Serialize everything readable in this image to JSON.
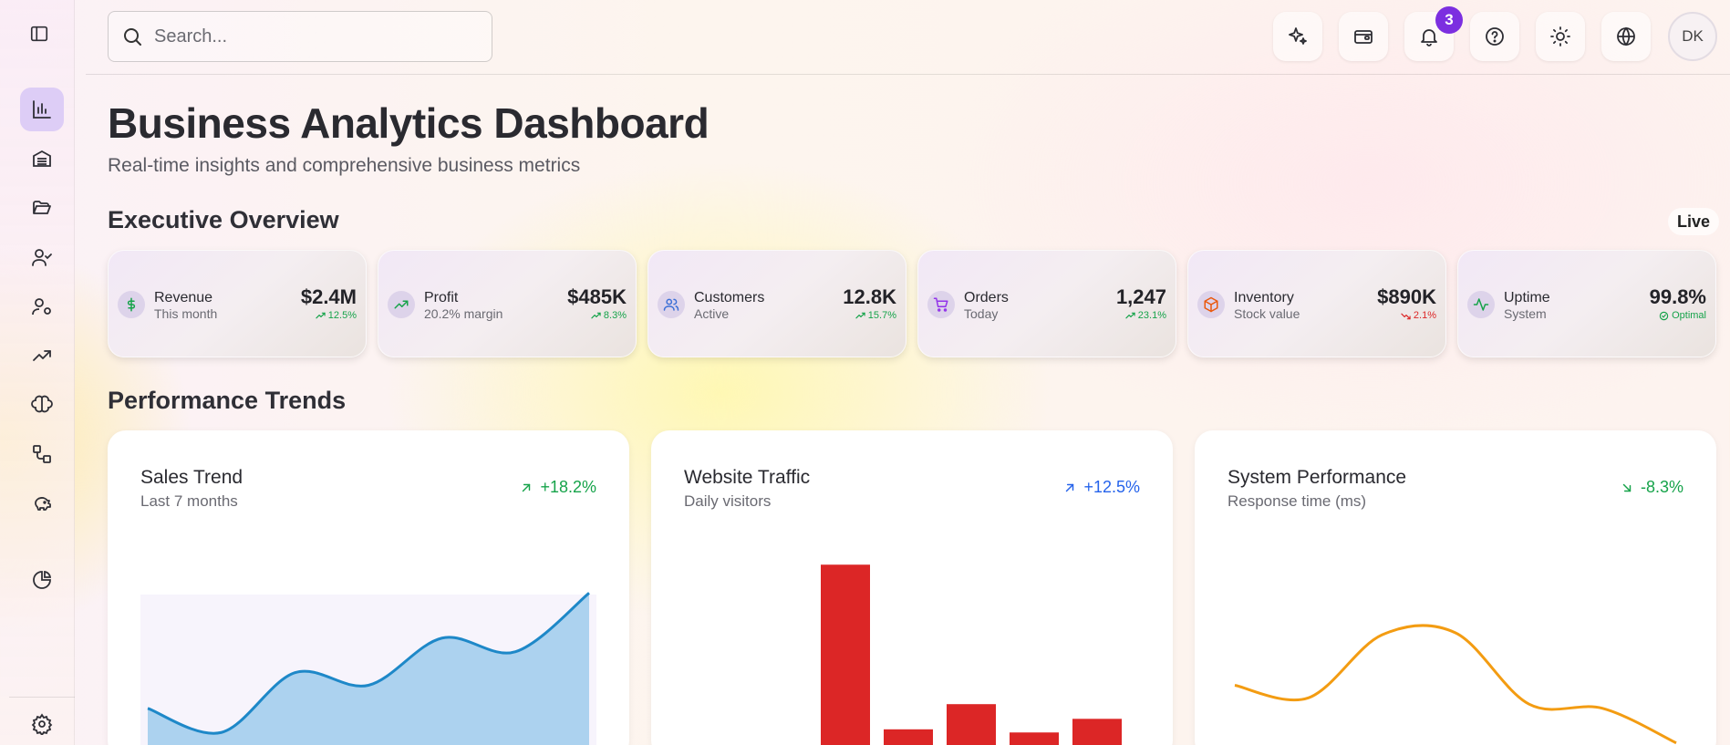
{
  "search": {
    "placeholder": "Search..."
  },
  "notifications": {
    "count": "3"
  },
  "user": {
    "initials": "DK"
  },
  "page": {
    "title": "Business Analytics Dashboard",
    "subtitle": "Real-time insights and comprehensive business metrics"
  },
  "overview": {
    "title": "Executive Overview",
    "live_label": "Live",
    "kpis": [
      {
        "name": "revenue",
        "label": "Revenue",
        "sub": "This month",
        "value": "$2.4M",
        "delta": "12.5%",
        "direction": "up",
        "color": "#16a34a",
        "icon_color": "#16a34a",
        "icon": "dollar-icon"
      },
      {
        "name": "profit",
        "label": "Profit",
        "sub": "20.2% margin",
        "value": "$485K",
        "delta": "8.3%",
        "direction": "up",
        "color": "#16a34a",
        "icon_color": "#16a34a",
        "icon": "trending-up-icon"
      },
      {
        "name": "customers",
        "label": "Customers",
        "sub": "Active",
        "value": "12.8K",
        "delta": "15.7%",
        "direction": "up",
        "color": "#16a34a",
        "icon_color": "#3b6fd6",
        "icon": "users-icon"
      },
      {
        "name": "orders",
        "label": "Orders",
        "sub": "Today",
        "value": "1,247",
        "delta": "23.1%",
        "direction": "up",
        "color": "#16a34a",
        "icon_color": "#9333ea",
        "icon": "cart-icon"
      },
      {
        "name": "inventory",
        "label": "Inventory",
        "sub": "Stock value",
        "value": "$890K",
        "delta": "2.1%",
        "direction": "down",
        "color": "#dc2626",
        "icon_color": "#ea580c",
        "icon": "package-icon"
      },
      {
        "name": "uptime",
        "label": "Uptime",
        "sub": "System",
        "value": "99.8%",
        "delta": "Optimal",
        "direction": "ok",
        "color": "#16a34a",
        "icon_color": "#16a34a",
        "icon": "activity-icon"
      }
    ]
  },
  "trends": {
    "title": "Performance Trends",
    "cards": [
      {
        "name": "sales-trend",
        "title": "Sales Trend",
        "subtitle": "Last 7 months",
        "delta": "+18.2%",
        "direction": "up",
        "color": "#16a34a"
      },
      {
        "name": "website-traffic",
        "title": "Website Traffic",
        "subtitle": "Daily visitors",
        "delta": "+12.5%",
        "direction": "up",
        "color": "#2563eb"
      },
      {
        "name": "system-performance",
        "title": "System Performance",
        "subtitle": "Response time (ms)",
        "delta": "-8.3%",
        "direction": "down",
        "color": "#16a34a"
      }
    ]
  },
  "chart_data": [
    {
      "type": "area",
      "x": [
        1,
        2,
        3,
        4,
        5,
        6,
        7
      ],
      "values": [
        48,
        25,
        82,
        70,
        115,
        102,
        158
      ],
      "ylim": [
        0,
        200
      ],
      "color": "#1e88c8",
      "fill": "#acd2ef",
      "background": "#f7f4fc"
    },
    {
      "type": "bar",
      "categories": [
        "1",
        "2",
        "3",
        "4",
        "5"
      ],
      "values": [
        185,
        28,
        52,
        25,
        38
      ],
      "ylim": [
        0,
        200
      ],
      "color": "#dc2626"
    },
    {
      "type": "line",
      "x": [
        1,
        2,
        3,
        4,
        5,
        6,
        7
      ],
      "values": [
        70,
        58,
        118,
        120,
        52,
        48,
        15
      ],
      "ylim": [
        0,
        200
      ],
      "color": "#f39c12"
    }
  ],
  "colors": {
    "accent": "#7c2fe0",
    "active_nav": "#ddcdf6"
  }
}
